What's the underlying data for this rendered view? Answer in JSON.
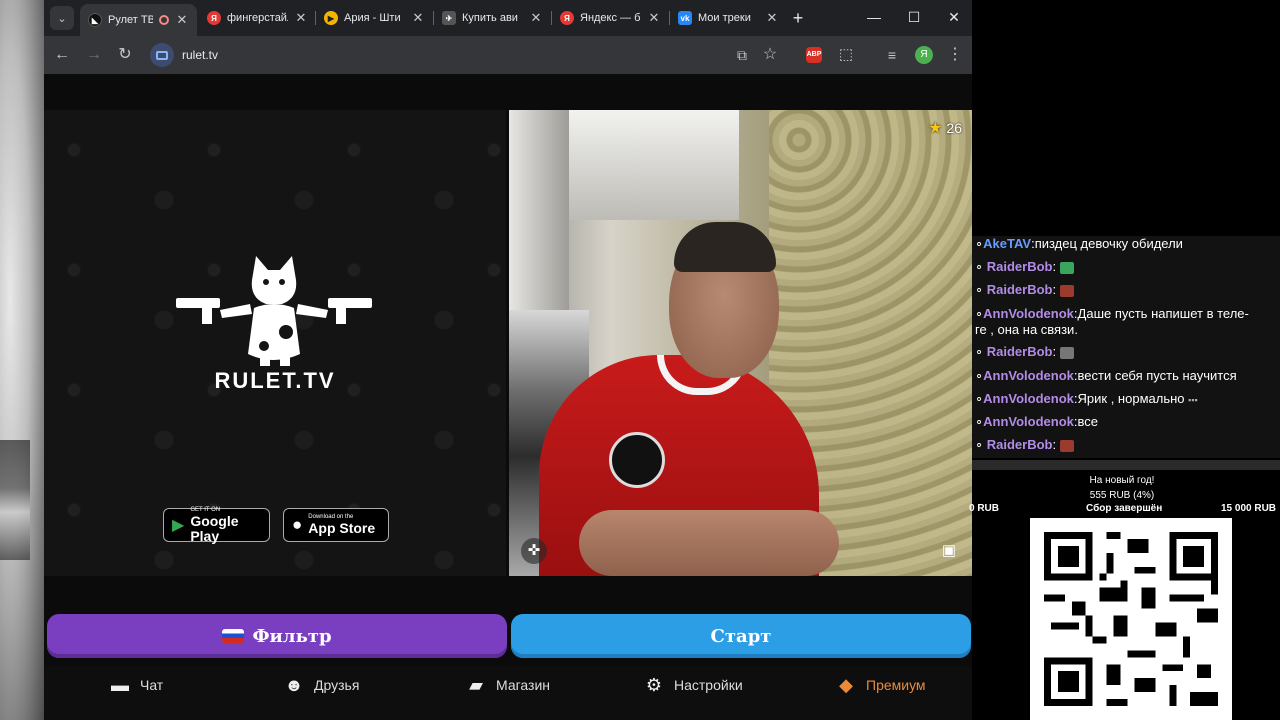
{
  "browser": {
    "tabs": [
      {
        "title": "Рулет ТВ",
        "favicon": "rulet",
        "color": "#111111",
        "active": true
      },
      {
        "title": "фингерстайл",
        "favicon": "yandex",
        "color": "#e53935",
        "active": false
      },
      {
        "title": "Ария - Шти",
        "favicon": "play",
        "color": "#f4b400",
        "active": false
      },
      {
        "title": "Купить ави",
        "favicon": "aviasales",
        "color": "#555555",
        "active": false
      },
      {
        "title": "Яндекс — б",
        "favicon": "yandex",
        "color": "#e53935",
        "active": false
      },
      {
        "title": "Мои треки",
        "favicon": "vk",
        "color": "#2787f5",
        "active": false
      }
    ],
    "new_tab": "+",
    "url": "rulet.tv",
    "abp_label": "ABP",
    "profile_letter": "Я"
  },
  "page": {
    "brand": "RULET.TV",
    "google_play": {
      "small": "GET IT ON",
      "big": "Google Play"
    },
    "app_store": {
      "small": "Download on the",
      "big": "App Store"
    },
    "star_count": "26",
    "filter_button": "Фильтр",
    "start_button": "Старт",
    "nav": [
      {
        "label": "Чат",
        "icon": "chat-icon"
      },
      {
        "label": "Друзья",
        "icon": "friends-icon"
      },
      {
        "label": "Магазин",
        "icon": "shop-icon"
      },
      {
        "label": "Настройки",
        "icon": "settings-icon"
      },
      {
        "label": "Премиум",
        "icon": "premium-icon"
      }
    ],
    "accent_purple": "#7a3fc0",
    "accent_blue": "#2b9ee6",
    "accent_orange": "#e88a3c"
  },
  "overlay": {
    "chat": [
      {
        "nick": "AkeTAV",
        "text": "пиздец девочку обидели",
        "color": "#6a9cff"
      },
      {
        "nick": "RaiderBob",
        "text": "",
        "emote": "#3aa55d"
      },
      {
        "nick": "RaiderBob",
        "text": "",
        "emote": "#9b3b2e"
      },
      {
        "nick": "AnnVolodenok",
        "text": "Даше пусть напишет в теле-",
        "cont": "ге , она на связи."
      },
      {
        "nick": "RaiderBob",
        "text": "",
        "emote": "#777777"
      },
      {
        "nick": "AnnVolodenok",
        "text": "вести себя пусть научится"
      },
      {
        "nick": "AnnVolodenok",
        "text": "Ярик , нормально"
      },
      {
        "nick": "AnnVolodenok",
        "text": "все"
      },
      {
        "nick": "RaiderBob",
        "text": "",
        "emote": "#9b3b2e"
      }
    ],
    "goal": {
      "title": "На новый год!",
      "amount": "555 RUB (4%)",
      "min": "0 RUB",
      "status": "Сбор завершён",
      "max": "15 000 RUB"
    }
  }
}
